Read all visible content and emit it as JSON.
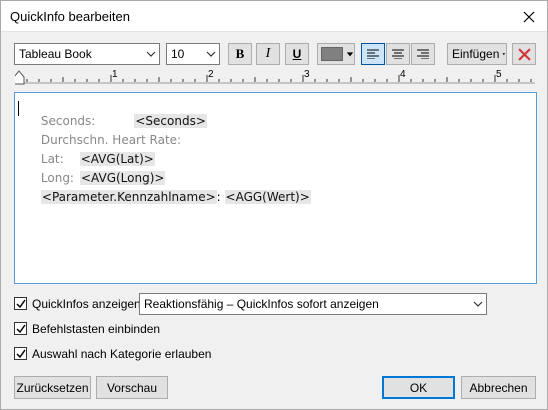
{
  "dialog": {
    "title": "QuickInfo bearbeiten"
  },
  "toolbar": {
    "font_family": "Tableau Book",
    "font_size": "10",
    "bold": "B",
    "italic": "I",
    "underline": "U",
    "text_color": "#808080",
    "align_left_active": true,
    "insert_label": "Einfügen"
  },
  "ruler": {
    "marks": [
      "1",
      "2",
      "3",
      "4",
      "5"
    ]
  },
  "editor": {
    "lines": [
      {
        "label": "Seconds:",
        "field": "<Seconds>"
      },
      {
        "label": "Durchschn. Heart Rate:",
        "field": ""
      },
      {
        "label": "Lat:",
        "field": "<AVG(Lat)>"
      },
      {
        "label": "Long:",
        "field": "<AVG(Long)>"
      },
      {
        "field_a": "<Parameter.Kennzahlname>",
        "sep": ":",
        "field_b": "<AGG(Wert)>"
      }
    ]
  },
  "options": {
    "show_tooltips": {
      "label": "QuickInfos anzeigen",
      "checked": true
    },
    "tooltip_mode": "Reaktionsfähig – QuickInfos sofort anzeigen",
    "command_buttons": {
      "label": "Befehlstasten einbinden",
      "checked": true
    },
    "select_by_category": {
      "label": "Auswahl nach Kategorie erlauben",
      "checked": true
    }
  },
  "buttons": {
    "reset": "Zurücksetzen",
    "preview": "Vorschau",
    "ok": "OK",
    "cancel": "Abbrechen"
  }
}
